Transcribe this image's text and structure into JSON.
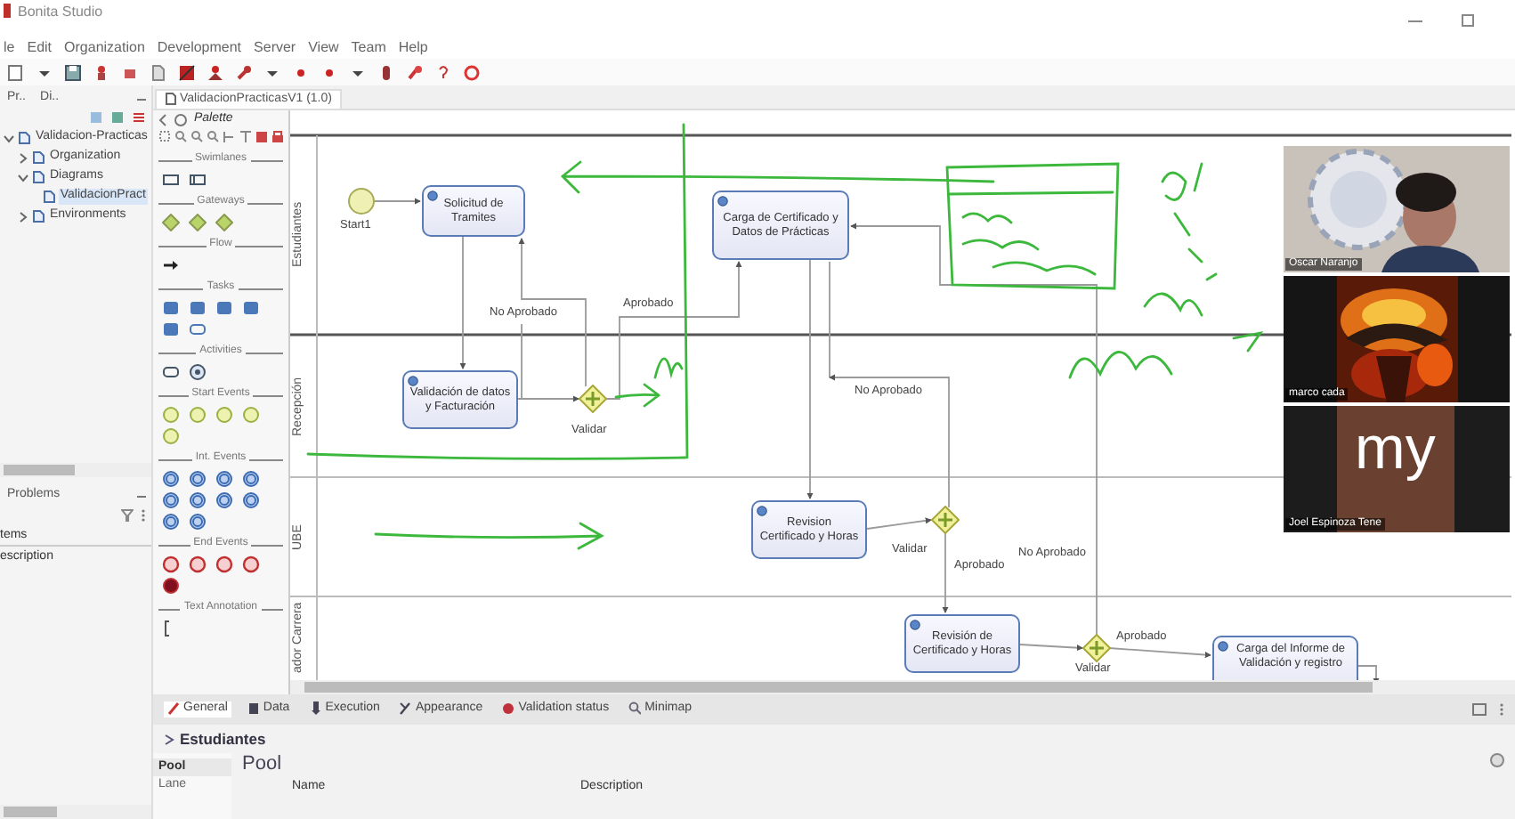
{
  "window": {
    "title": "Bonita Studio"
  },
  "menu": [
    "le",
    "Edit",
    "Organization",
    "Development",
    "Server",
    "View",
    "Team",
    "Help"
  ],
  "explorer": {
    "tabs": [
      {
        "label": "Pr.."
      },
      {
        "label": "Di.."
      }
    ],
    "tree": [
      {
        "label": "Validacion-Practicas",
        "expanded": true,
        "selected": false,
        "children": [
          {
            "label": "Organization",
            "expanded": false,
            "selected": false
          },
          {
            "label": "Diagrams",
            "expanded": true,
            "selected": false,
            "children": [
              {
                "label": "ValidacionPract",
                "selected": true
              }
            ]
          },
          {
            "label": "Environments",
            "expanded": false,
            "selected": false
          }
        ]
      }
    ]
  },
  "problems": {
    "tab": "Problems",
    "column": "tems",
    "row": "escription"
  },
  "editor": {
    "tab": "ValidacionPracticasV1 (1.0)"
  },
  "palette": {
    "title": "Palette",
    "sections": [
      {
        "label": "Swimlanes"
      },
      {
        "label": "Gateways"
      },
      {
        "label": "Flow"
      },
      {
        "label": "Tasks"
      },
      {
        "label": "Activities"
      },
      {
        "label": "Start Events"
      },
      {
        "label": "Int. Events"
      },
      {
        "label": "End Events"
      },
      {
        "label": "Text Annotation"
      }
    ]
  },
  "diagram": {
    "lanes": [
      {
        "label": "Estudiantes"
      },
      {
        "label": "Recepción"
      },
      {
        "label": "UBE"
      },
      {
        "label": "ador Carrera"
      }
    ],
    "nodes": [
      {
        "kind": "start",
        "label": "Start1"
      },
      {
        "kind": "task",
        "label": "Solicitud de Tramites"
      },
      {
        "kind": "task",
        "label": "Carga de Certificado y Datos de Prácticas"
      },
      {
        "kind": "task",
        "label": "Validación de datos y Facturación"
      },
      {
        "kind": "gateway",
        "label": "Validar"
      },
      {
        "kind": "task",
        "label": "Revision Certificado y Horas"
      },
      {
        "kind": "gateway",
        "label": "Validar"
      },
      {
        "kind": "task",
        "label": "Revisión de Certificado y Horas"
      },
      {
        "kind": "gateway",
        "label": "Validar"
      },
      {
        "kind": "task",
        "label": "Carga del Informe de Validación y registro"
      }
    ],
    "flow_labels": [
      "No Aprobado",
      "Aprobado",
      "No Aprobado",
      "Aprobado",
      "No Aprobado",
      "Aprobado"
    ]
  },
  "participants": [
    {
      "kind": "camera",
      "name": "Oscar Naranjo"
    },
    {
      "kind": "picture",
      "name": "marco cada"
    },
    {
      "kind": "initials",
      "initials": "my",
      "name": "Joel Espinoza Tene"
    }
  ],
  "properties": {
    "tabs": [
      {
        "label": "General",
        "selected": true
      },
      {
        "label": "Data",
        "selected": false
      },
      {
        "label": "Execution",
        "selected": false
      },
      {
        "label": "Appearance",
        "selected": false
      },
      {
        "label": "Validation status",
        "selected": false
      },
      {
        "label": "Minimap",
        "selected": false
      }
    ],
    "title": "Estudiantes",
    "nav": [
      {
        "label": "Pool",
        "selected": true
      },
      {
        "label": "Lane",
        "selected": false
      }
    ],
    "heading": "Pool",
    "columns": [
      "Name",
      "Description"
    ]
  }
}
